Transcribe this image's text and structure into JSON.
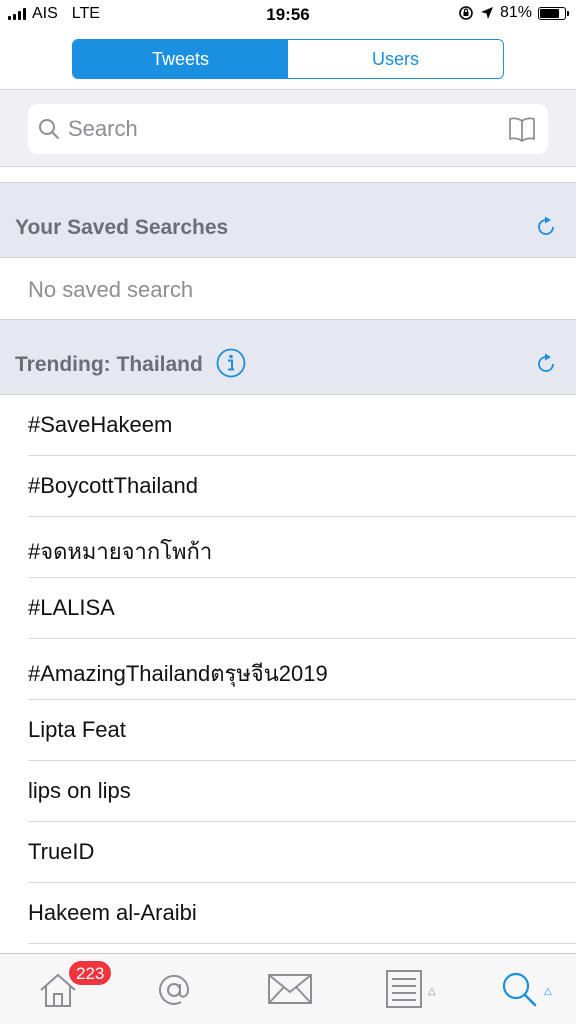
{
  "status_bar": {
    "carrier": "AIS",
    "network": "LTE",
    "time": "19:56",
    "battery_percent": "81%",
    "battery_level": 0.81
  },
  "segmented_control": {
    "tweets_label": "Tweets",
    "users_label": "Users",
    "selected": "Tweets"
  },
  "search": {
    "placeholder": "Search",
    "value": ""
  },
  "saved_searches": {
    "title": "Your Saved Searches",
    "empty_text": "No saved search"
  },
  "trending": {
    "title": "Trending: Thailand",
    "items": [
      "#SaveHakeem",
      "#BoycottThailand",
      "#จดหมายจากโพก้า",
      "#LALISA",
      "#AmazingThailandตรุษจีน2019",
      "Lipta Feat",
      "lips on lips",
      "TrueID",
      "Hakeem al-Araibi"
    ]
  },
  "tab_bar": {
    "home_badge": "223",
    "active_tab": "search"
  },
  "colors": {
    "accent": "#1b8fe0",
    "badge": "#f0353e",
    "section_bg": "#e6e8f0",
    "icon_gray": "#8e8e93"
  }
}
